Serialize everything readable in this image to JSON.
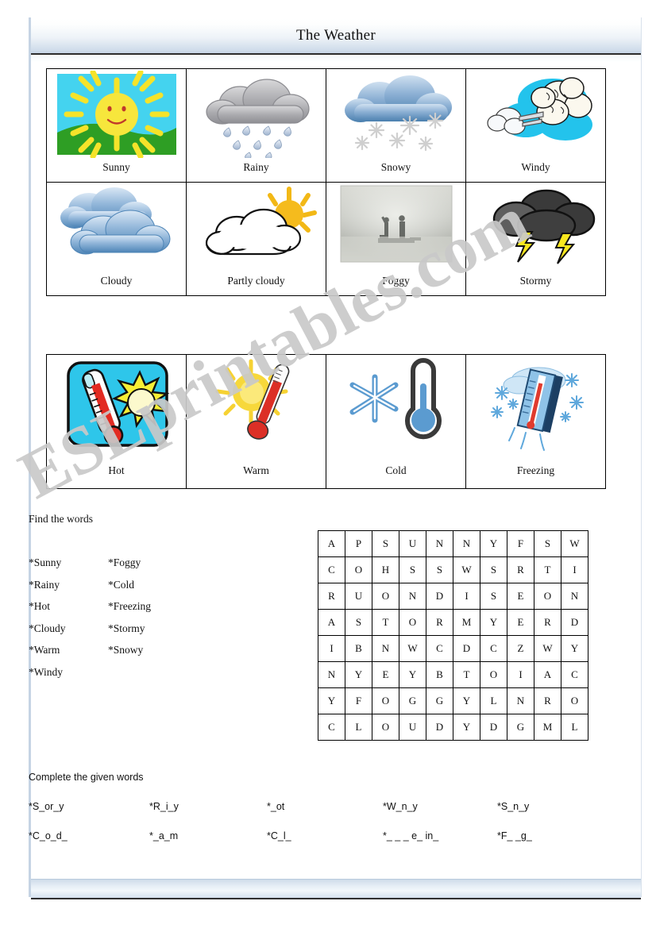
{
  "header": {
    "title": "The Weather"
  },
  "watermark": {
    "text": "ESLprintables.com",
    "color": "#c9c9c9"
  },
  "weather_cards": [
    {
      "label": "Sunny",
      "icon": "sun-with-face-icon"
    },
    {
      "label": "Rainy",
      "icon": "rain-cloud-icon"
    },
    {
      "label": "Snowy",
      "icon": "snow-cloud-icon"
    },
    {
      "label": "Windy",
      "icon": "wind-blowing-cloud-icon"
    },
    {
      "label": "Cloudy",
      "icon": "two-clouds-icon"
    },
    {
      "label": "Partly cloudy",
      "icon": "sun-behind-cloud-icon"
    },
    {
      "label": "Foggy",
      "icon": "fog-photo"
    },
    {
      "label": "Stormy",
      "icon": "storm-cloud-lightning-icon"
    }
  ],
  "temperature_cards": [
    {
      "label": "Hot",
      "icon": "thermometer-sun-icon"
    },
    {
      "label": "Warm",
      "icon": "thermometer-warm-icon"
    },
    {
      "label": "Cold",
      "icon": "thermometer-snowflake-icon"
    },
    {
      "label": "Freezing",
      "icon": "frozen-thermometer-icon"
    }
  ],
  "find_words": {
    "title": "Find the words",
    "column1": [
      "*Sunny",
      "*Rainy",
      "*Hot",
      "*Cloudy",
      "*Warm",
      "*Windy"
    ],
    "column2": [
      "*Foggy",
      "*Cold",
      "*Freezing",
      "*Stormy",
      "*Snowy"
    ]
  },
  "word_search": {
    "rows": [
      [
        "A",
        "P",
        "S",
        "U",
        "N",
        "N",
        "Y",
        "F",
        "S",
        "W"
      ],
      [
        "C",
        "O",
        "H",
        "S",
        "S",
        "W",
        "S",
        "R",
        "T",
        "I"
      ],
      [
        "R",
        "U",
        "O",
        "N",
        "D",
        "I",
        "S",
        "E",
        "O",
        "N"
      ],
      [
        "A",
        "S",
        "T",
        "O",
        "R",
        "M",
        "Y",
        "E",
        "R",
        "D"
      ],
      [
        "I",
        "B",
        "N",
        "W",
        "C",
        "D",
        "C",
        "Z",
        "W",
        "Y"
      ],
      [
        "N",
        "Y",
        "E",
        "Y",
        "B",
        "T",
        "O",
        "I",
        "A",
        "C"
      ],
      [
        "Y",
        "F",
        "O",
        "G",
        "G",
        "Y",
        "L",
        "N",
        "R",
        "O"
      ],
      [
        "C",
        "L",
        "O",
        "U",
        "D",
        "Y",
        "D",
        "G",
        "M",
        "L"
      ]
    ]
  },
  "complete_words": {
    "title": "Complete the given words",
    "row1": [
      "*S_or_y",
      "*R_i_y",
      "*_ot",
      "*W_n_y",
      "*S_n_y"
    ],
    "row2": [
      "*C_o_d_",
      "*_a_m",
      "*C_l_",
      "*_ _ _ e_ in_",
      "*F_ _g_"
    ]
  }
}
